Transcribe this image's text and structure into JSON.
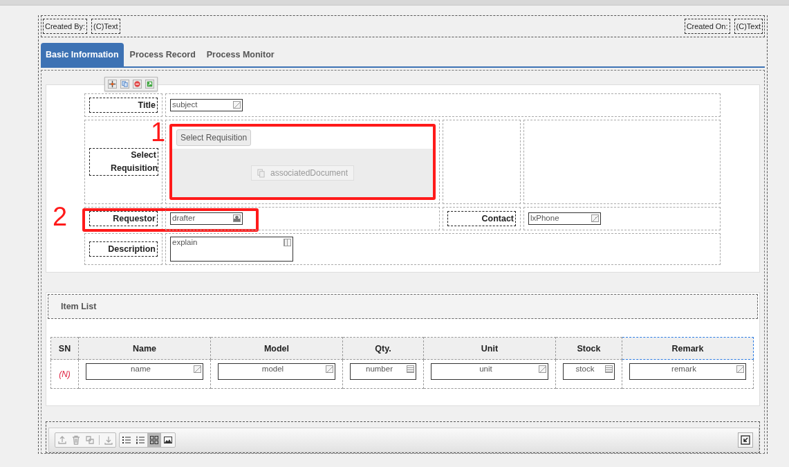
{
  "header": {
    "created_by": {
      "label": "Created By:",
      "value": "(C)Text"
    },
    "created_on": {
      "label": "Created On:",
      "value": "(C)Text"
    }
  },
  "tabs": [
    {
      "label": "Basic Information",
      "selected": true
    },
    {
      "label": "Process Record",
      "selected": false
    },
    {
      "label": "Process Monitor",
      "selected": false
    }
  ],
  "form": {
    "title": {
      "label": "Title",
      "field": {
        "kind": "text",
        "value": "subject"
      }
    },
    "select_requisition": {
      "label": "Select Requisition",
      "button": "Select Requisition",
      "document": "associatedDocument"
    },
    "requestor": {
      "label": "Requestor",
      "field": {
        "kind": "person",
        "value": "drafter"
      }
    },
    "contact": {
      "label": "Contact",
      "field": {
        "kind": "text",
        "value": "lxPhone"
      }
    },
    "description": {
      "label": "Description",
      "field": {
        "kind": "textarea",
        "value": "explain"
      }
    }
  },
  "annotations": [
    {
      "label": "1"
    },
    {
      "label": "2"
    }
  ],
  "item_list": {
    "title": "Item List",
    "columns": [
      {
        "label": "SN",
        "selected": false
      },
      {
        "label": "Name",
        "selected": false
      },
      {
        "label": "Model",
        "selected": false
      },
      {
        "label": "Qty.",
        "selected": false
      },
      {
        "label": "Unit",
        "selected": false
      },
      {
        "label": "Stock",
        "selected": false
      },
      {
        "label": "Remark",
        "selected": true
      }
    ],
    "rows": [
      {
        "cells": [
          {
            "kind": "sn",
            "value": "(N)"
          },
          {
            "kind": "text",
            "value": "name"
          },
          {
            "kind": "text",
            "value": "model"
          },
          {
            "kind": "number",
            "value": "number"
          },
          {
            "kind": "text",
            "value": "unit"
          },
          {
            "kind": "number",
            "value": "stock"
          },
          {
            "kind": "text",
            "value": "remark"
          }
        ]
      }
    ]
  },
  "attachment_toolbar": {
    "buttons": [
      {
        "kind": "upload",
        "disabled": true,
        "selected": false
      },
      {
        "kind": "delete",
        "disabled": true,
        "selected": false
      },
      {
        "kind": "copy",
        "disabled": true,
        "selected": false
      },
      {
        "kind": "download",
        "disabled": true,
        "selected": false
      },
      {
        "kind": "bullet-list",
        "disabled": false,
        "selected": false
      },
      {
        "kind": "numbered-list",
        "disabled": false,
        "selected": false
      },
      {
        "kind": "grid",
        "disabled": false,
        "selected": true
      },
      {
        "kind": "image",
        "disabled": false,
        "selected": false
      }
    ]
  }
}
